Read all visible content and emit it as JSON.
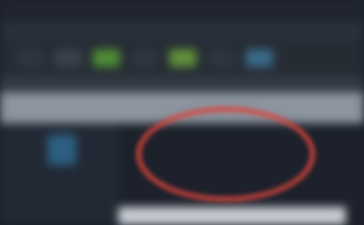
{
  "screen": {
    "description_visible_text": "",
    "blurred": true
  },
  "colors": {
    "background": "#1b202b",
    "ribbon": "#262c34",
    "band": "#8b949f",
    "accent_green": "#4e8c35",
    "accent_blue": "#3a6a8a",
    "highlight_red": "#d8453c"
  },
  "ribbon": {
    "buttons": [
      {
        "icon": "generic-icon"
      },
      {
        "icon": "generic-icon"
      },
      {
        "icon": "green-action-icon"
      },
      {
        "icon": "generic-icon"
      },
      {
        "icon": "green-action-icon"
      },
      {
        "icon": "generic-icon"
      },
      {
        "icon": "blue-action-icon"
      }
    ]
  }
}
